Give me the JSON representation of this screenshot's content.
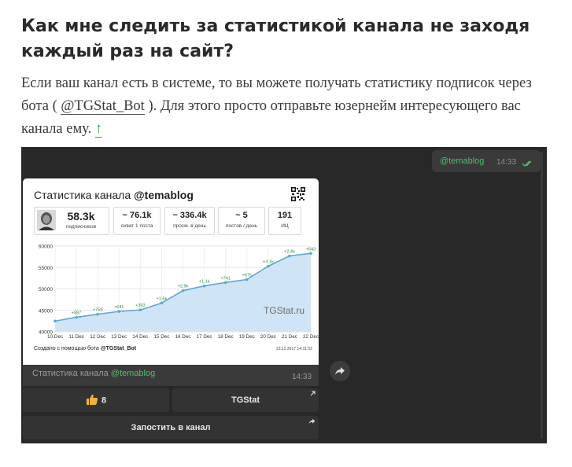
{
  "faq": {
    "title": "Как мне следить за статистикой канала не заходя каждый раз на сайт?",
    "body_before": "Если ваш канал есть в системе, то вы можете получать статистику подписок через бота ( ",
    "bot_link": "@TGStat_Bot",
    "body_after": " ). Для этого просто отправьте юзернейм интересующего вас канала ему. ",
    "up_link": "↑"
  },
  "chat": {
    "outgoing": {
      "text": "@temablog",
      "time": "14:33"
    },
    "card": {
      "title_prefix": "Статистика канала ",
      "title_channel": "@temablog",
      "stats": [
        {
          "value": "58.3k",
          "label": "подписчиков"
        },
        {
          "value": "~ 76.1k",
          "label": "охват 1 поста"
        },
        {
          "value": "~ 336.4k",
          "label": "просм. в день"
        },
        {
          "value": "~ 5",
          "label": "постов / день"
        },
        {
          "value": "191",
          "label": "ИЦ"
        }
      ],
      "footer_prefix": "Создано с помощью бота ",
      "footer_bot": "@TGStat_Bot",
      "footer_date": "23.12.2017 14:31:53"
    },
    "caption": {
      "prefix": "Статистика канала ",
      "channel": "@temablog",
      "time": "14:33"
    },
    "buttons": {
      "like_count": "8",
      "tgstat": "TGStat",
      "post": "Запостить в канал"
    },
    "icons": [
      "double-check-icon",
      "share-icon",
      "thumbs-up-icon",
      "external-link-icon",
      "qr-code-icon"
    ],
    "colors": {
      "accent_green": "#4fbd6a",
      "chart_line": "#5fa7cf",
      "chart_fill": "#cfe5f6",
      "bg_dark": "#282828"
    }
  },
  "chart_data": {
    "type": "area",
    "x": [
      "10 Dec",
      "11 Dec",
      "12 Dec",
      "13 Dec",
      "14 Dec",
      "15 Dec",
      "16 Dec",
      "17 Dec",
      "18 Dec",
      "19 Dec",
      "20 Dec",
      "21 Dec",
      "22 Dec"
    ],
    "values": [
      42500,
      43380,
      44100,
      44750,
      45100,
      46700,
      49600,
      50700,
      51500,
      52200,
      55300,
      57700,
      58300
    ],
    "point_labels": [
      "",
      "+887",
      "+759",
      "+641",
      "+393",
      "+1.6k",
      "+2.9k",
      "+1.1k",
      "+741",
      "+675",
      "+3.1k",
      "+2.4k",
      "+543"
    ],
    "yticks": [
      "40000",
      "45000",
      "50000",
      "55000",
      "60000"
    ],
    "ylim": [
      40000,
      60000
    ],
    "watermark": "TGStat.ru",
    "grid": true
  }
}
